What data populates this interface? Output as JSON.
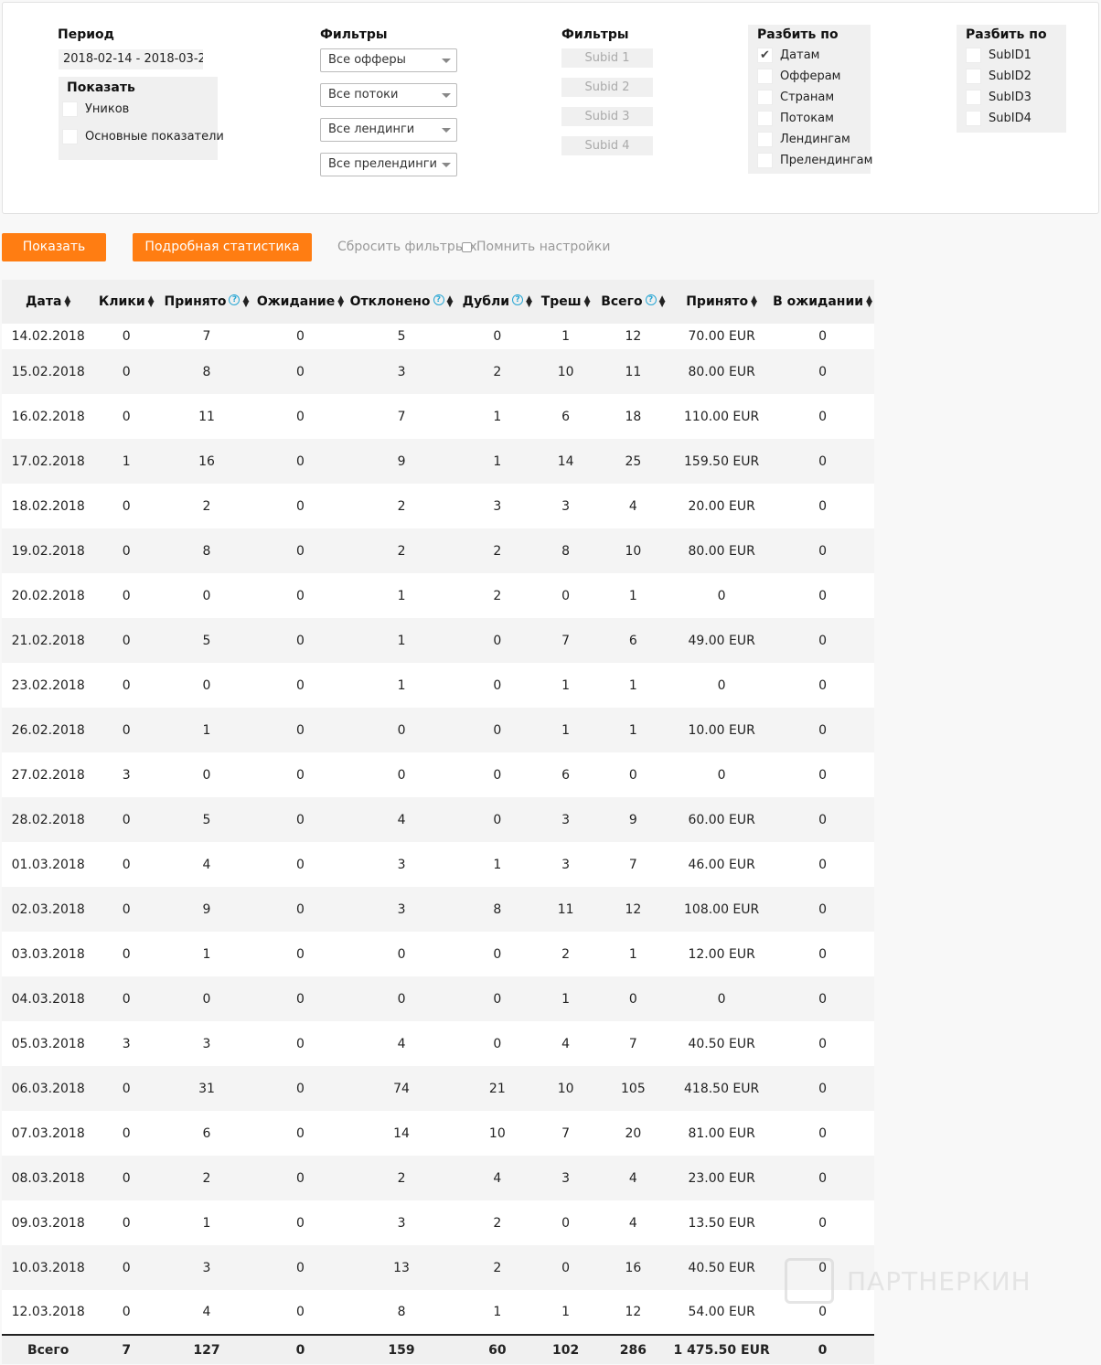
{
  "filters": {
    "period_label": "Период",
    "period_value": "2018-02-14 - 2018-03-2",
    "show_label": "Показать",
    "show_options": [
      "Уников",
      "Основные показатели"
    ],
    "filters_label_1": "Фильтры",
    "selects": [
      "Все офферы",
      "Все потоки",
      "Все лендинги",
      "Все прелендинги"
    ],
    "filters_label_2": "Фильтры",
    "subid_placeholders": [
      "Subid 1",
      "Subid 2",
      "Subid 3",
      "Subid 4"
    ],
    "split_label_1": "Разбить по",
    "split_options": [
      "Датам",
      "Офферам",
      "Странам",
      "Потокам",
      "Лендингам",
      "Прелендингам"
    ],
    "split_checked": "Датам",
    "split_label_2": "Разбить по",
    "split_subid_options": [
      "SubID1",
      "SubID2",
      "SubID3",
      "SubID4"
    ]
  },
  "actions": {
    "show_button": "Показать",
    "detailed_button": "Подробная статистика",
    "reset_link": "Сбросить фильтры x",
    "remember_label": "Помнить настройки"
  },
  "table": {
    "columns": [
      "Дата",
      "Клики",
      "Принято",
      "Ожидание",
      "Отклонено",
      "Дубли",
      "Треш",
      "Всего",
      "Принято",
      "В ожидании"
    ],
    "help_icon": "?",
    "rows": [
      [
        "14.02.2018",
        "0",
        "7",
        "0",
        "5",
        "0",
        "1",
        "12",
        "70.00 EUR",
        "0"
      ],
      [
        "15.02.2018",
        "0",
        "8",
        "0",
        "3",
        "2",
        "10",
        "11",
        "80.00 EUR",
        "0"
      ],
      [
        "16.02.2018",
        "0",
        "11",
        "0",
        "7",
        "1",
        "6",
        "18",
        "110.00 EUR",
        "0"
      ],
      [
        "17.02.2018",
        "1",
        "16",
        "0",
        "9",
        "1",
        "14",
        "25",
        "159.50 EUR",
        "0"
      ],
      [
        "18.02.2018",
        "0",
        "2",
        "0",
        "2",
        "3",
        "3",
        "4",
        "20.00 EUR",
        "0"
      ],
      [
        "19.02.2018",
        "0",
        "8",
        "0",
        "2",
        "2",
        "8",
        "10",
        "80.00 EUR",
        "0"
      ],
      [
        "20.02.2018",
        "0",
        "0",
        "0",
        "1",
        "2",
        "0",
        "1",
        "0",
        "0"
      ],
      [
        "21.02.2018",
        "0",
        "5",
        "0",
        "1",
        "0",
        "7",
        "6",
        "49.00 EUR",
        "0"
      ],
      [
        "23.02.2018",
        "0",
        "0",
        "0",
        "1",
        "0",
        "1",
        "1",
        "0",
        "0"
      ],
      [
        "26.02.2018",
        "0",
        "1",
        "0",
        "0",
        "0",
        "1",
        "1",
        "10.00 EUR",
        "0"
      ],
      [
        "27.02.2018",
        "3",
        "0",
        "0",
        "0",
        "0",
        "6",
        "0",
        "0",
        "0"
      ],
      [
        "28.02.2018",
        "0",
        "5",
        "0",
        "4",
        "0",
        "3",
        "9",
        "60.00 EUR",
        "0"
      ],
      [
        "01.03.2018",
        "0",
        "4",
        "0",
        "3",
        "1",
        "3",
        "7",
        "46.00 EUR",
        "0"
      ],
      [
        "02.03.2018",
        "0",
        "9",
        "0",
        "3",
        "8",
        "11",
        "12",
        "108.00 EUR",
        "0"
      ],
      [
        "03.03.2018",
        "0",
        "1",
        "0",
        "0",
        "0",
        "2",
        "1",
        "12.00 EUR",
        "0"
      ],
      [
        "04.03.2018",
        "0",
        "0",
        "0",
        "0",
        "0",
        "1",
        "0",
        "0",
        "0"
      ],
      [
        "05.03.2018",
        "3",
        "3",
        "0",
        "4",
        "0",
        "4",
        "7",
        "40.50 EUR",
        "0"
      ],
      [
        "06.03.2018",
        "0",
        "31",
        "0",
        "74",
        "21",
        "10",
        "105",
        "418.50 EUR",
        "0"
      ],
      [
        "07.03.2018",
        "0",
        "6",
        "0",
        "14",
        "10",
        "7",
        "20",
        "81.00 EUR",
        "0"
      ],
      [
        "08.03.2018",
        "0",
        "2",
        "0",
        "2",
        "4",
        "3",
        "4",
        "23.00 EUR",
        "0"
      ],
      [
        "09.03.2018",
        "0",
        "1",
        "0",
        "3",
        "2",
        "0",
        "4",
        "13.50 EUR",
        "0"
      ],
      [
        "10.03.2018",
        "0",
        "3",
        "0",
        "13",
        "2",
        "0",
        "16",
        "40.50 EUR",
        "0"
      ],
      [
        "12.03.2018",
        "0",
        "4",
        "0",
        "8",
        "1",
        "1",
        "12",
        "54.00 EUR",
        "0"
      ]
    ],
    "totals": [
      "Всего",
      "7",
      "127",
      "0",
      "159",
      "60",
      "102",
      "286",
      "1 475.50 EUR",
      "0"
    ]
  },
  "watermark": "ПАРТНЕРКИН",
  "colors": {
    "accent": "#ff7d12",
    "link": "#2aa7d4"
  }
}
